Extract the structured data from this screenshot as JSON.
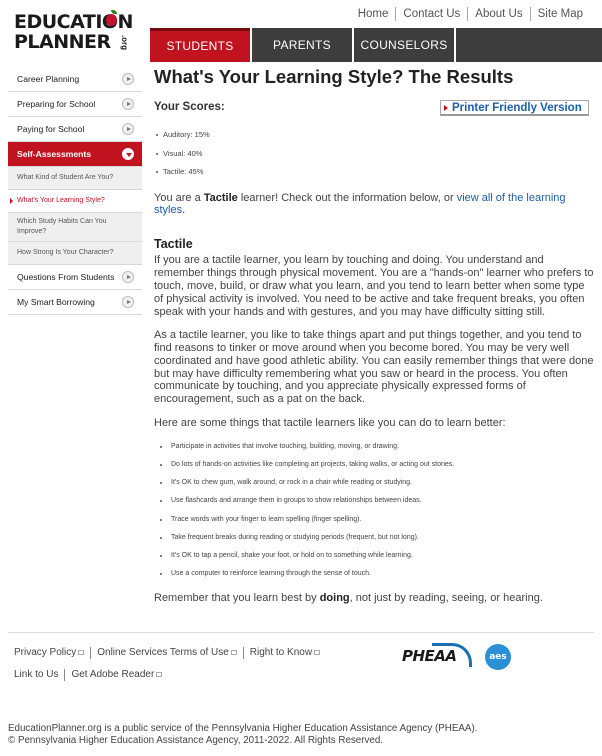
{
  "header": {
    "logo": {
      "line1": "EDUCATION",
      "line2": "PLANNER",
      "suffix": ".org"
    },
    "top_links": [
      "Home",
      "Contact Us",
      "About Us",
      "Site Map"
    ],
    "tabs": [
      {
        "label": "STUDENTS",
        "active": true
      },
      {
        "label": "PARENTS",
        "active": false
      },
      {
        "label": "COUNSELORS",
        "active": false
      }
    ]
  },
  "sidebar": {
    "items": [
      {
        "label": "Career Planning"
      },
      {
        "label": "Preparing for School"
      },
      {
        "label": "Paying for School"
      },
      {
        "label": "Self-Assessments"
      },
      {
        "label": "What Kind of Student Are You?"
      },
      {
        "label": "What's Your Learning Style?"
      },
      {
        "label": "Which Study Habits Can You Improve?"
      },
      {
        "label": "How Strong Is Your Character?"
      },
      {
        "label": "Questions From Students"
      },
      {
        "label": "My Smart Borrowing"
      }
    ]
  },
  "main": {
    "title": "What's Your Learning Style? The Results",
    "scores_title": "Your Scores:",
    "printer_link": "Printer Friendly Version",
    "scores": [
      "Auditory: 15%",
      "Visual: 40%",
      "Tactile: 45%"
    ],
    "learner_prefix": "You are a ",
    "learner_type": "Tactile",
    "learner_mid": " learner! Check out the information below, or ",
    "learner_link": "view all of the learning styles",
    "learner_end": ".",
    "section_title": "Tactile",
    "para1": "If you are a tactile learner, you learn by touching and doing. You understand and remember things through physical movement. You are a \"hands-on\" learner who prefers to touch, move, build, or draw what you learn, and you tend to learn better when some type of physical activity is involved. You need to be active and take frequent breaks, you often speak with your hands and with gestures, and you may have difficulty sitting still.",
    "para2": "As a tactile learner, you like to take things apart and put things together, and you tend to find reasons to tinker or move around when you become bored. You may be very well coordinated and have good athletic ability. You can easily remember things that were done but may have difficulty remembering what you saw or heard in the process. You often communicate by touching, and you appreciate physically expressed forms of encouragement, such as a pat on the back.",
    "para3": "Here are some things that tactile learners like you can do to learn better:",
    "tips": [
      "Participate in activities that involve touching, building, moving, or drawing.",
      "Do lots of hands-on activities like completing art projects, taking walks, or acting out stories.",
      "It's OK to chew gum, walk around, or rock in a chair while reading or studying.",
      "Use flashcards and arrange them in groups to show relationships between ideas.",
      "Trace words with your finger to learn spelling (finger spelling).",
      "Take frequent breaks during reading or studying periods (frequent, but not long).",
      "It's OK to tap a pencil, shake your foot, or hold on to something while learning.",
      "Use a computer to reinforce learning through the sense of touch."
    ],
    "closing_prefix": "Remember that you learn best by ",
    "closing_bold": "doing",
    "closing_end": ", not just by reading, seeing, or hearing."
  },
  "footer": {
    "row1": [
      "Privacy Policy",
      "Online Services Terms of Use",
      "Right to Know"
    ],
    "row2": [
      "Link to Us",
      "Get Adobe Reader"
    ],
    "pheaa_logo": "PHEAA",
    "aes_logo": "aes",
    "note1": "EducationPlanner.org is a public service of the Pennsylvania Higher Education Assistance Agency (PHEAA).",
    "note2": "© Pennsylvania Higher Education Assistance Agency, 2011-2022. All Rights Reserved."
  }
}
